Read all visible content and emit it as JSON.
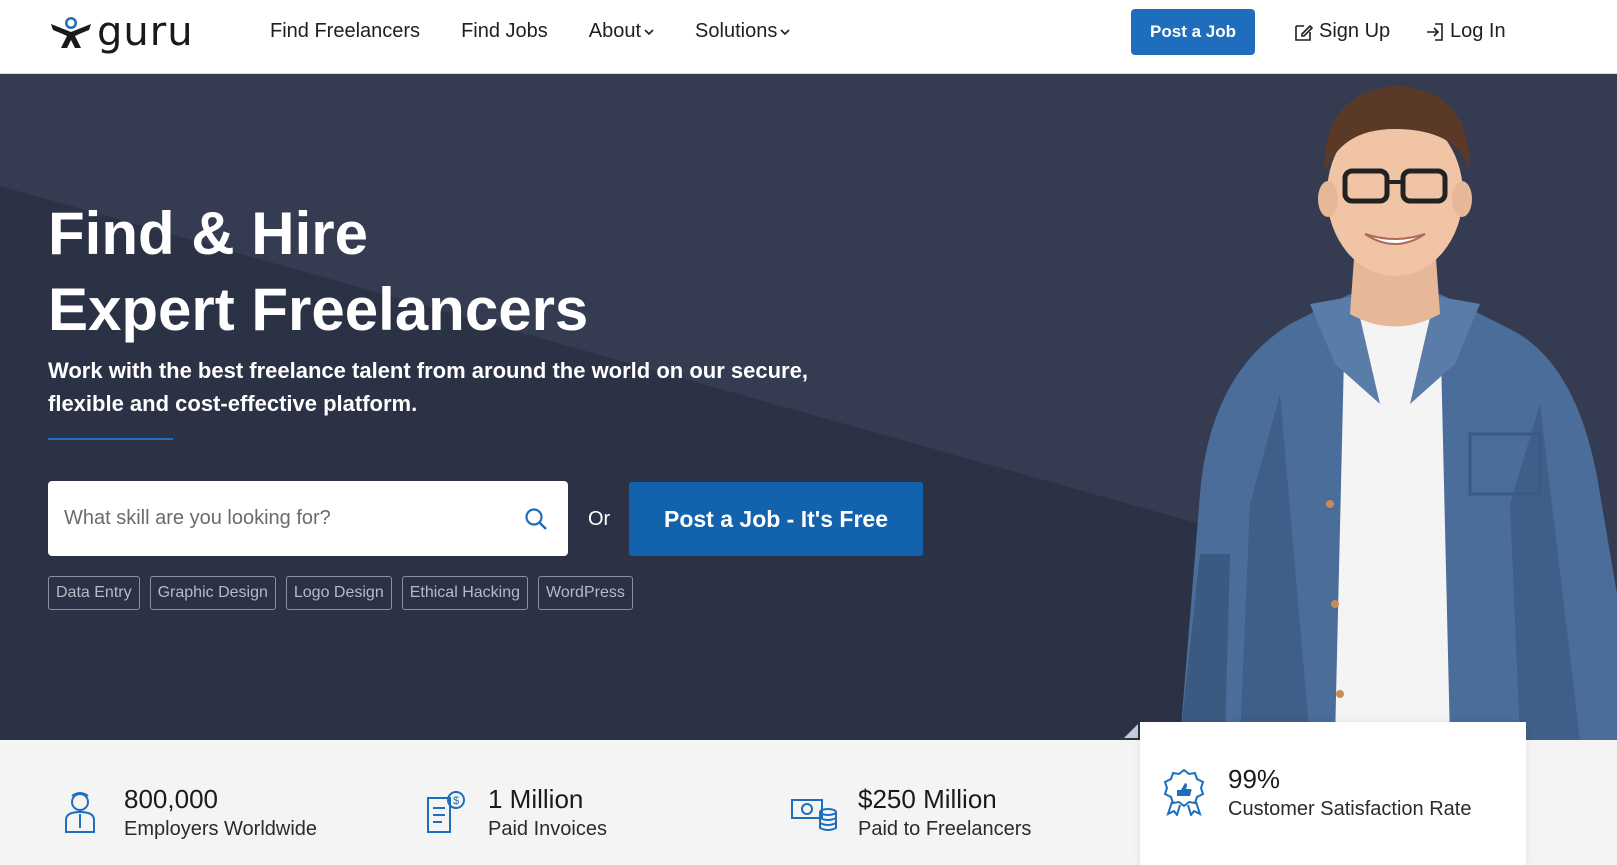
{
  "header": {
    "logo_text": "guru",
    "nav": [
      {
        "label": "Find Freelancers",
        "has_dropdown": false
      },
      {
        "label": "Find Jobs",
        "has_dropdown": false
      },
      {
        "label": "About",
        "has_dropdown": true
      },
      {
        "label": "Solutions",
        "has_dropdown": true
      }
    ],
    "post_job_label": "Post a Job",
    "signup_label": "Sign Up",
    "login_label": "Log In"
  },
  "hero": {
    "title_line1": "Find & Hire",
    "title_line2": "Expert Freelancers",
    "subtitle": "Work with the best freelance talent from around the world on our secure, flexible and cost-effective platform.",
    "search_placeholder": "What skill are you looking for?",
    "search_value": "",
    "or_text": "Or",
    "post_job_cta": "Post a Job - It's Free",
    "tags": [
      "Data Entry",
      "Graphic Design",
      "Logo Design",
      "Ethical Hacking",
      "WordPress"
    ]
  },
  "stats": [
    {
      "value": "800,000",
      "label": "Employers Worldwide",
      "icon": "employer-icon"
    },
    {
      "value": "1 Million",
      "label": "Paid Invoices",
      "icon": "invoice-icon"
    },
    {
      "value": "$250 Million",
      "label": "Paid to Freelancers",
      "icon": "money-icon"
    },
    {
      "value": "99%",
      "label": "Customer Satisfaction Rate",
      "icon": "award-icon"
    }
  ],
  "colors": {
    "brand_blue": "#1e6ebd",
    "cta_blue": "#1262ad",
    "hero_bg": "#2c3245",
    "hero_bg_light": "#353c52"
  }
}
